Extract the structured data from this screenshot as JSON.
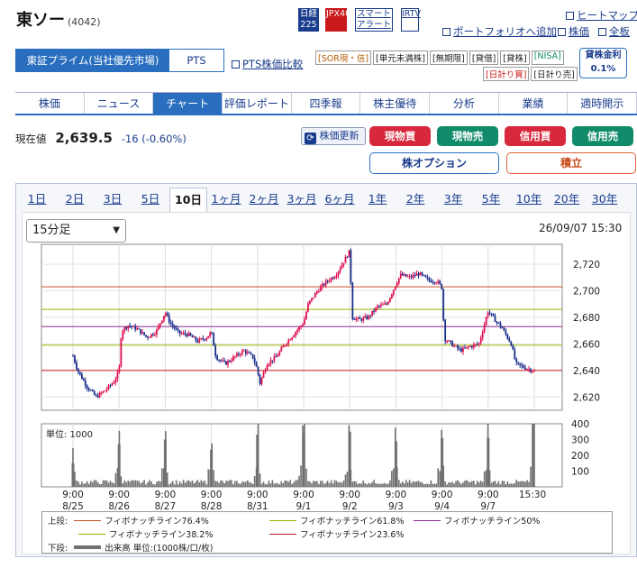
{
  "stock": {
    "name": "東ソー",
    "code": "(4042)"
  },
  "tools": [
    "日経225",
    "JPX400",
    "スマートアラート",
    "IRTV"
  ],
  "top_links": {
    "heatmap": "ヒートマップ",
    "portfolio": "ポートフォリオへ追加",
    "stock": "株価",
    "all": "全板"
  },
  "market_tabs": {
    "active": "東証プライム(当社優先市場)",
    "other": "PTS"
  },
  "pts_compare": "PTS株価比較",
  "badges": [
    "[SOR現・信]",
    "[単元未満株]",
    "[無期限]",
    "[貸借]",
    "[貸株]",
    "[NISA]",
    "[日計り買]",
    "[日計り売]"
  ],
  "lending": {
    "label": "貸株金利",
    "rate": "0.1%"
  },
  "nav_tabs": [
    "株価",
    "ニュース",
    "チャート",
    "評価レポート",
    "四季報",
    "株主優待",
    "分析",
    "業績",
    "適時開示"
  ],
  "price": {
    "label": "現在値",
    "value": "2,639.5",
    "change": "-16 (-0.60%)"
  },
  "actions": {
    "refresh": "株価更新",
    "buy": "現物買",
    "sell": "現物売",
    "margin_buy": "信用買",
    "margin_sell": "信用売",
    "option": "株オプション",
    "tsumitate": "積立"
  },
  "range_tabs": [
    "1日",
    "2日",
    "3日",
    "5日",
    "10日",
    "1ヶ月",
    "2ヶ月",
    "3ヶ月",
    "6ヶ月",
    "1年",
    "2年",
    "3年",
    "5年",
    "10年",
    "20年",
    "30年"
  ],
  "interval": "15分足",
  "timestamp": "26/09/07 15:30",
  "volume_unit": "単位: 1000",
  "x_ticks": [
    {
      "time": "9:00",
      "date": "8/25"
    },
    {
      "time": "9:00",
      "date": "8/26"
    },
    {
      "time": "9:00",
      "date": "8/27"
    },
    {
      "time": "9:00",
      "date": "8/28"
    },
    {
      "time": "9:00",
      "date": "8/31"
    },
    {
      "time": "9:00",
      "date": "9/1"
    },
    {
      "time": "9:00",
      "date": "9/2"
    },
    {
      "time": "9:00",
      "date": "9/3"
    },
    {
      "time": "9:00",
      "date": "9/4"
    },
    {
      "time": "9:00",
      "date": "9/7"
    },
    {
      "time": "15:30",
      "date": ""
    }
  ],
  "legend": {
    "upper_label": "上段:",
    "lower_label": "下段:",
    "items": [
      "フィボナッチライン76.4%",
      "フィボナッチライン61.8%",
      "フィボナッチライン50%",
      "フィボナッチライン38.2%",
      "フィボナッチライン23.6%"
    ],
    "volume": "出来高 単位:(1000株/口/枚)"
  },
  "colors": {
    "fib76": "#c7502a",
    "fib618": "#9ab600",
    "fib50": "#8a2d8f",
    "fib382": "#9ab600",
    "fib236": "#c81a1a",
    "up": "#e01050",
    "down": "#1a2e8c",
    "volume": "#707070"
  },
  "chart_data": {
    "type": "line",
    "y_ticks": [
      "2,720",
      "2,700",
      "2,680",
      "2,660",
      "2,640",
      "2,620"
    ],
    "ylim": [
      2610,
      2735
    ],
    "fibonacci": [
      {
        "name": "フィボナッチライン76.4%",
        "value": 2703
      },
      {
        "name": "フィボナッチライン61.8%",
        "value": 2686
      },
      {
        "name": "フィボナッチライン50%",
        "value": 2673
      },
      {
        "name": "フィボナッチライン38.2%",
        "value": 2659
      },
      {
        "name": "フィボナッチライン23.6%",
        "value": 2640
      }
    ],
    "price_path": [
      [
        0,
        2651
      ],
      [
        0.1,
        2640
      ],
      [
        0.3,
        2628
      ],
      [
        0.5,
        2620
      ],
      [
        0.7,
        2625
      ],
      [
        0.9,
        2632
      ],
      [
        1.0,
        2640
      ],
      [
        1.05,
        2670
      ],
      [
        1.2,
        2674
      ],
      [
        1.4,
        2671
      ],
      [
        1.6,
        2665
      ],
      [
        1.8,
        2669
      ],
      [
        2.0,
        2684
      ],
      [
        2.1,
        2676
      ],
      [
        2.3,
        2668
      ],
      [
        2.5,
        2667
      ],
      [
        2.7,
        2662
      ],
      [
        2.9,
        2665
      ],
      [
        3.0,
        2669
      ],
      [
        3.1,
        2650
      ],
      [
        3.3,
        2645
      ],
      [
        3.5,
        2650
      ],
      [
        3.7,
        2655
      ],
      [
        3.9,
        2650
      ],
      [
        4.0,
        2640
      ],
      [
        4.05,
        2630
      ],
      [
        4.2,
        2645
      ],
      [
        4.4,
        2650
      ],
      [
        4.6,
        2660
      ],
      [
        4.8,
        2668
      ],
      [
        5.0,
        2676
      ],
      [
        5.1,
        2690
      ],
      [
        5.3,
        2700
      ],
      [
        5.5,
        2707
      ],
      [
        5.7,
        2712
      ],
      [
        5.9,
        2724
      ],
      [
        6.0,
        2730
      ],
      [
        6.05,
        2680
      ],
      [
        6.2,
        2678
      ],
      [
        6.4,
        2680
      ],
      [
        6.6,
        2688
      ],
      [
        6.8,
        2690
      ],
      [
        7.0,
        2705
      ],
      [
        7.1,
        2712
      ],
      [
        7.3,
        2710
      ],
      [
        7.5,
        2713
      ],
      [
        7.7,
        2708
      ],
      [
        7.9,
        2707
      ],
      [
        8.0,
        2702
      ],
      [
        8.05,
        2664
      ],
      [
        8.2,
        2660
      ],
      [
        8.4,
        2655
      ],
      [
        8.6,
        2658
      ],
      [
        8.8,
        2660
      ],
      [
        9.0,
        2685
      ],
      [
        9.1,
        2680
      ],
      [
        9.3,
        2672
      ],
      [
        9.5,
        2660
      ],
      [
        9.6,
        2645
      ],
      [
        9.8,
        2642
      ],
      [
        10.0,
        2639.5
      ]
    ],
    "volume_ticks": [
      "400",
      "300",
      "200",
      "100"
    ],
    "volume_max": 400,
    "volume_spikes": [
      {
        "day": 0,
        "value": 150
      },
      {
        "day": 1,
        "value": 270
      },
      {
        "day": 2,
        "value": 300
      },
      {
        "day": 3,
        "value": 235
      },
      {
        "day": 4,
        "value": 330
      },
      {
        "day": 5,
        "value": 340
      },
      {
        "day": 6,
        "value": 350
      },
      {
        "day": 7,
        "value": 290
      },
      {
        "day": 8,
        "value": 310
      },
      {
        "day": 9,
        "value": 310
      },
      {
        "day": 9.98,
        "value": 400
      }
    ]
  }
}
